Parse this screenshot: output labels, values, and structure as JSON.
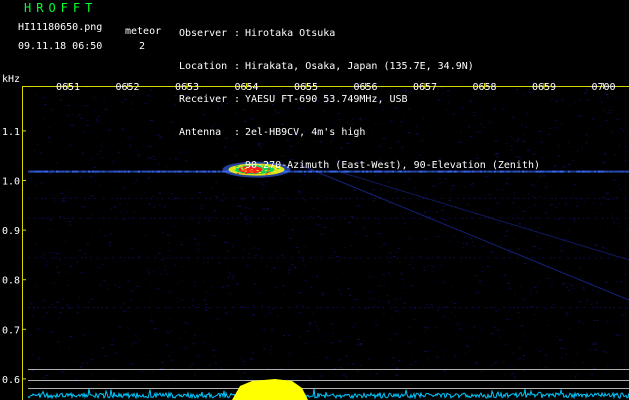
{
  "app": {
    "title": "HROFFT",
    "file_name": "HI11180650.png",
    "timestamp": "09.11.18 06:50",
    "meteor_label": "meteor",
    "meteor_count": "2"
  },
  "info": [
    {
      "key": "Observer",
      "sep": ":",
      "value": "Hirotaka Otsuka"
    },
    {
      "key": "Location",
      "sep": ":",
      "value": "Hirakata, Osaka, Japan (135.7E, 34.9N)"
    },
    {
      "key": "Receiver",
      "sep": ":",
      "value": "YAESU FT-690 53.749MHz, USB"
    },
    {
      "key": "Antenna",
      "sep": ":",
      "value": "2el-HB9CV, 4m's high"
    },
    {
      "key": "",
      "sep": "",
      "value": "90-270-Azimuth (East-West), 90-Elevation (Zenith)"
    }
  ],
  "chart_data": {
    "type": "heatmap",
    "ylabel": "kHz",
    "x_ticks": [
      "0651",
      "0652",
      "0653",
      "0654",
      "0655",
      "0656",
      "0657",
      "0658",
      "0659",
      "0700"
    ],
    "y_ticks": [
      {
        "label": "1.1",
        "value": 1.1
      },
      {
        "label": "1.0",
        "value": 1.0
      },
      {
        "label": "0.9",
        "value": 0.9
      },
      {
        "label": "0.8",
        "value": 0.8
      },
      {
        "label": "0.7",
        "value": 0.7
      },
      {
        "label": "0.6",
        "value": 0.6
      }
    ],
    "carrier_frequency_khz": 1.02,
    "meteor_echo": {
      "time": "0654",
      "frequency_khz": 1.02
    },
    "colors": {
      "axis": "#d8d800",
      "tick_label": "#ffffff",
      "noise": "#101070",
      "carrier": "#3a6cff",
      "echo_core": "#ff2020",
      "echo_mid": "#00d060",
      "echo_edge": "#ffff00",
      "level_trace": "#00c8ff",
      "level_peak": "#ffff00",
      "reference_line": "#b0b0b0"
    }
  }
}
